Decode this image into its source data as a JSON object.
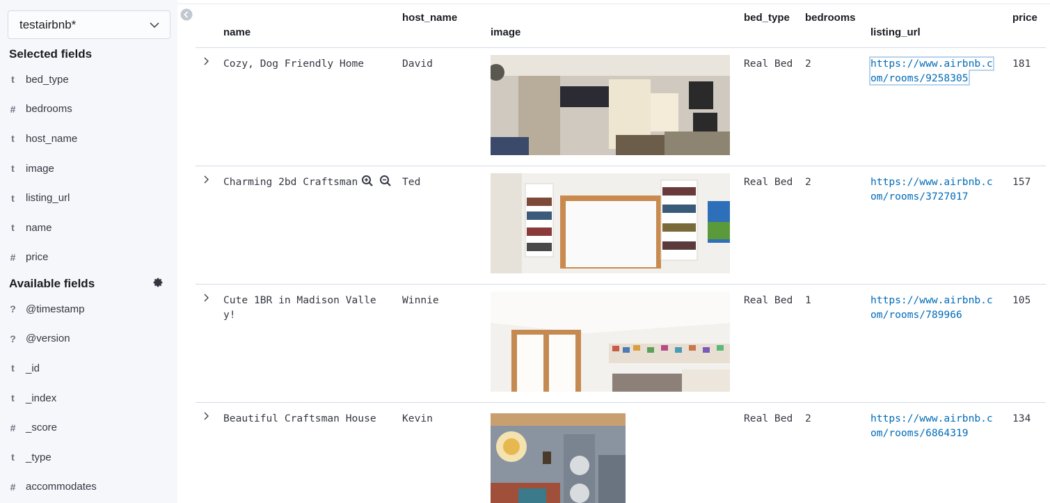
{
  "sidebar": {
    "index_pattern": "testairbnb*",
    "selected_title": "Selected fields",
    "available_title": "Available fields",
    "selected_fields": [
      {
        "type": "t",
        "name": "bed_type"
      },
      {
        "type": "#",
        "name": "bedrooms"
      },
      {
        "type": "t",
        "name": "host_name"
      },
      {
        "type": "t",
        "name": "image"
      },
      {
        "type": "t",
        "name": "listing_url"
      },
      {
        "type": "t",
        "name": "name"
      },
      {
        "type": "#",
        "name": "price"
      }
    ],
    "available_fields": [
      {
        "type": "?",
        "name": "@timestamp"
      },
      {
        "type": "?",
        "name": "@version"
      },
      {
        "type": "t",
        "name": "_id"
      },
      {
        "type": "t",
        "name": "_index"
      },
      {
        "type": "#",
        "name": "_score"
      },
      {
        "type": "t",
        "name": "_type"
      },
      {
        "type": "#",
        "name": "accommodates"
      }
    ]
  },
  "table": {
    "columns": [
      "name",
      "host_name",
      "image",
      "bed_type",
      "bedrooms",
      "listing_url",
      "price"
    ],
    "rows": [
      {
        "name": "Cozy, Dog Friendly Home",
        "host_name": "David",
        "bed_type": "Real Bed",
        "bedrooms": "2",
        "listing_url": "https://www.airbnb.com/rooms/9258305",
        "price": "181"
      },
      {
        "name": "Charming 2bd Craftsman",
        "host_name": "Ted",
        "bed_type": "Real Bed",
        "bedrooms": "2",
        "listing_url": "https://www.airbnb.com/rooms/3727017",
        "price": "157"
      },
      {
        "name": "Cute 1BR in Madison Valley!",
        "host_name": "Winnie",
        "bed_type": "Real Bed",
        "bedrooms": "1",
        "listing_url": "https://www.airbnb.com/rooms/789966",
        "price": "105"
      },
      {
        "name": "Beautiful Craftsman House",
        "host_name": "Kevin",
        "bed_type": "Real Bed",
        "bedrooms": "2",
        "listing_url": "https://www.airbnb.com/rooms/6864319",
        "price": "134"
      }
    ]
  },
  "colors": {
    "link": "#006bb8",
    "sidebar_bg": "#f5f7fa",
    "border": "#d3dae6"
  }
}
